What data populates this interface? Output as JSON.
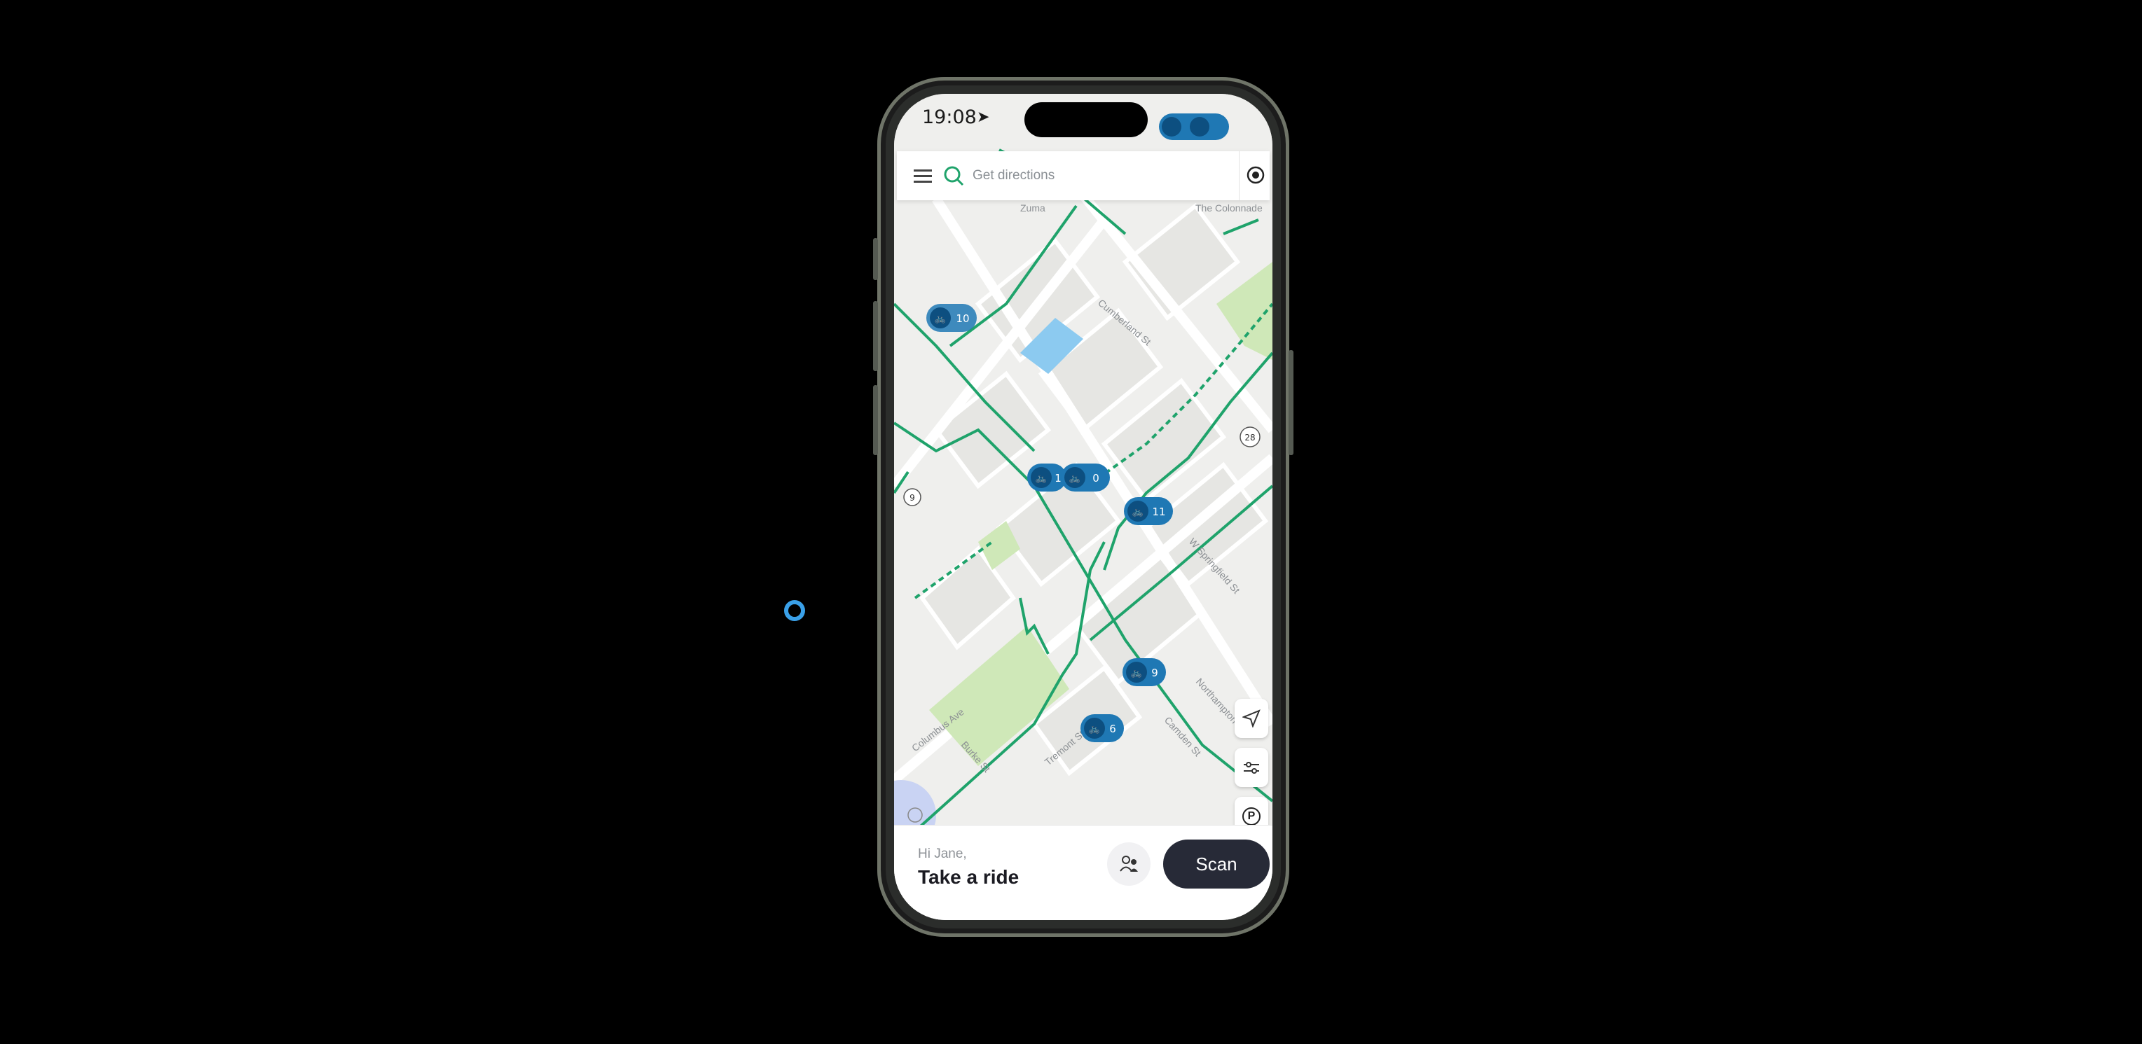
{
  "status_bar": {
    "time": "19:08",
    "location_icon": "location-arrow-icon"
  },
  "search": {
    "menu_icon": "hamburger-menu-icon",
    "search_icon": "search-icon",
    "placeholder": "Get directions",
    "right_icon": "map-pin-icon"
  },
  "map": {
    "street_labels": [
      {
        "text": "Zuma"
      },
      {
        "text": "The Colonnade"
      },
      {
        "text": "Cumberland St"
      },
      {
        "text": "W Springfield St"
      },
      {
        "text": "Northampton St"
      },
      {
        "text": "Camden St"
      },
      {
        "text": "Burke St"
      },
      {
        "text": "Columbus Ave"
      },
      {
        "text": "Tremont St"
      }
    ],
    "route_shields": [
      "9",
      "28"
    ],
    "stations": [
      {
        "count": "10",
        "bikes": 1
      },
      {
        "count": "1",
        "bikes": 1
      },
      {
        "count": "0",
        "bikes": 1
      },
      {
        "count": "11",
        "bikes": 1
      },
      {
        "count": "9",
        "bikes": 1
      },
      {
        "count": "6",
        "bikes": 1
      }
    ],
    "colors": {
      "bike_lane": "#1fa36b",
      "station_pin": "#1f78b4",
      "park": "#cfe8b8",
      "water": "#8ccaf0",
      "road": "#ffffff",
      "block": "#ebebe9"
    }
  },
  "controls": {
    "locate_icon": "navigation-arrow-icon",
    "filter_icon": "filter-sliders-icon",
    "parking_label": "P"
  },
  "panel": {
    "greeting": "Hi Jane,",
    "cta": "Take a ride",
    "group_icon": "group-ride-icon",
    "scan_label": "Scan"
  }
}
